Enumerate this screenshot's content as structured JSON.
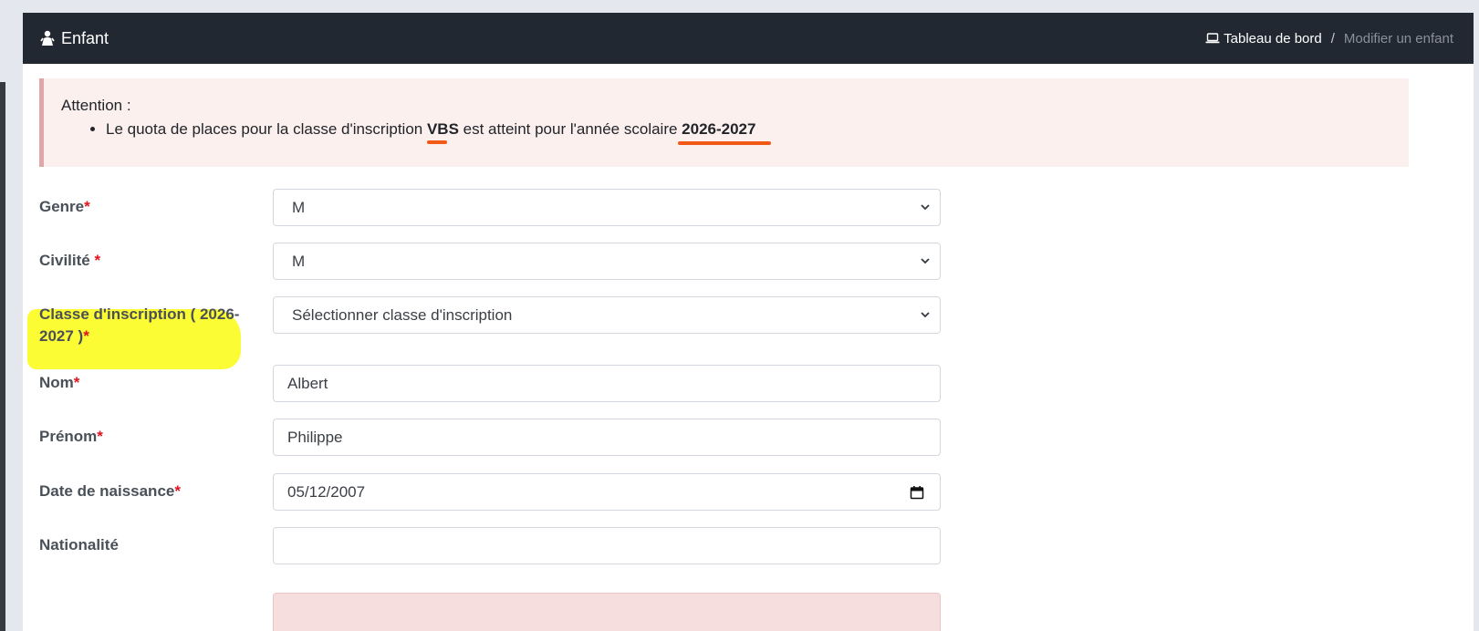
{
  "header": {
    "title": "Enfant",
    "breadcrumb": {
      "home": "Tableau de bord",
      "separator": "/",
      "current": "Modifier un enfant"
    }
  },
  "alert": {
    "title": "Attention :",
    "text_before": "Le quota de places pour la classe d'inscription ",
    "class_code": "VBS",
    "text_middle": " est atteint pour l'année scolaire ",
    "year": "2026-2027"
  },
  "form": {
    "genre": {
      "label": "Genre",
      "value": "M"
    },
    "civilite": {
      "label": "Civilité ",
      "value": "M"
    },
    "classe": {
      "label": "Classe d'inscription ( 2026-2027 )",
      "placeholder": "Sélectionner classe d'inscription"
    },
    "nom": {
      "label": "Nom",
      "value": "Albert"
    },
    "prenom": {
      "label": "Prénom",
      "value": "Philippe"
    },
    "naissance": {
      "label": "Date de naissance",
      "value": "05/12/2007"
    },
    "nationalite": {
      "label": "Nationalité",
      "value": ""
    },
    "required_mark": "*"
  },
  "colors": {
    "header_bg": "#222831",
    "alert_bg": "#fcf0ef",
    "required": "#e3131b",
    "annotation_underline": "#f05a16",
    "annotation_highlight": "#fcfc2a"
  }
}
